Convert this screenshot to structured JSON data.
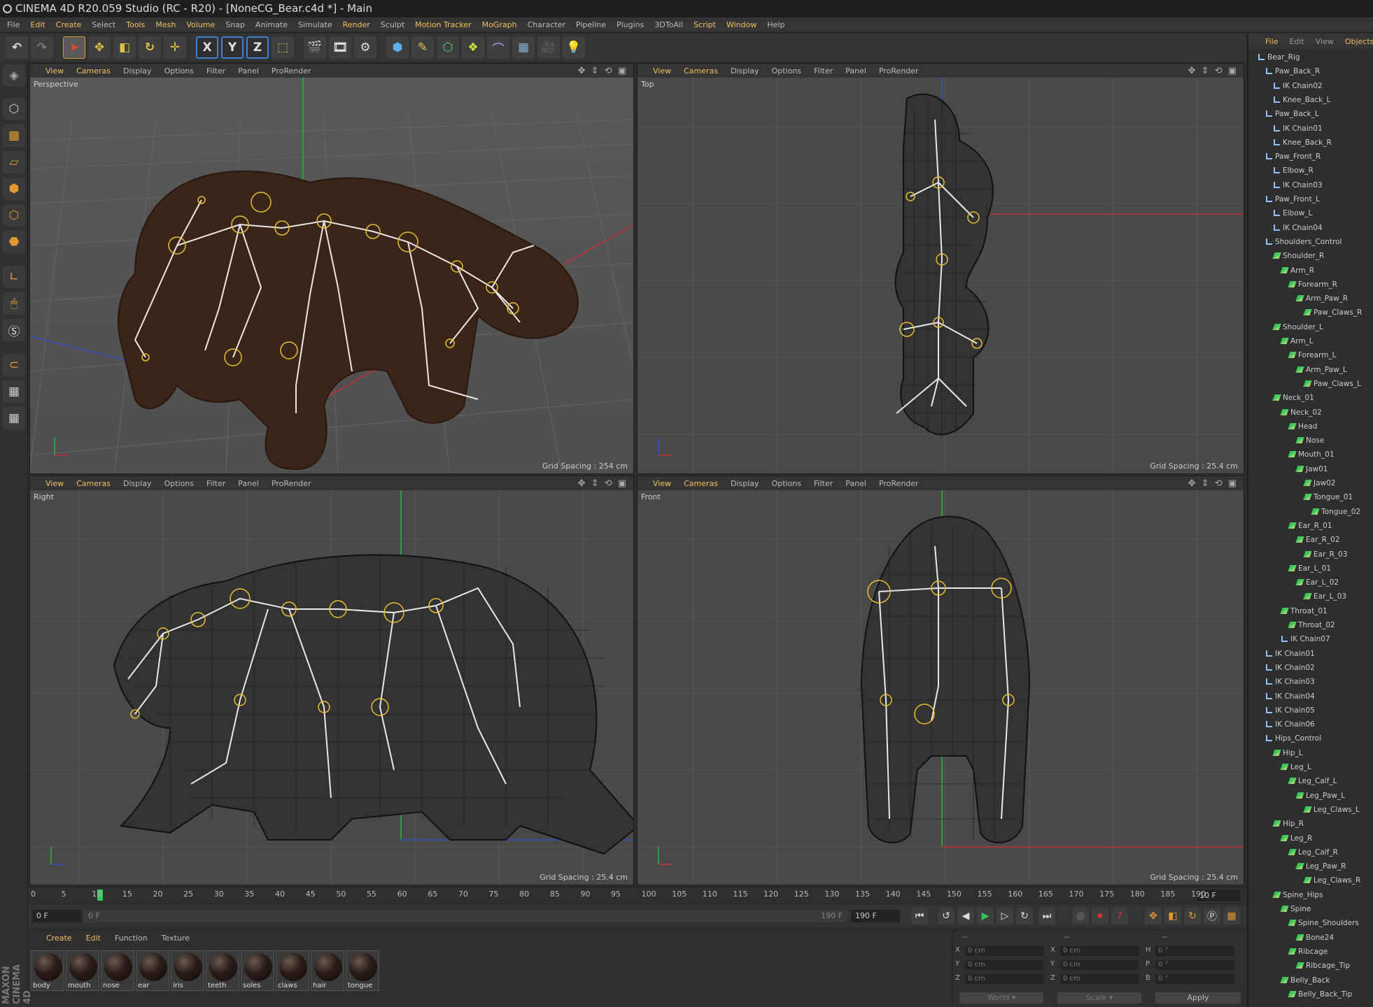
{
  "window": {
    "title": "CINEMA 4D R20.059 Studio (RC - R20) - [NoneCG_Bear.c4d *] - Main"
  },
  "menu": [
    "File",
    "Edit",
    "Create",
    "Select",
    "Tools",
    "Mesh",
    "Volume",
    "Snap",
    "Animate",
    "Simulate",
    "Render",
    "Sculpt",
    "Motion Tracker",
    "MoGraph",
    "Character",
    "Pipeline",
    "Plugins",
    "3DToAll",
    "Script",
    "Window",
    "Help"
  ],
  "viewport_menu": [
    "View",
    "Cameras",
    "Display",
    "Options",
    "Filter",
    "Panel",
    "ProRender"
  ],
  "viewports": [
    {
      "name": "Perspective",
      "grid": "Grid Spacing : 254 cm"
    },
    {
      "name": "Top",
      "grid": "Grid Spacing : 25.4 cm"
    },
    {
      "name": "Right",
      "grid": "Grid Spacing : 25.4 cm"
    },
    {
      "name": "Front",
      "grid": "Grid Spacing : 25.4 cm"
    }
  ],
  "timeline": {
    "ticks": [
      "0",
      "5",
      "10",
      "15",
      "20",
      "25",
      "30",
      "35",
      "40",
      "45",
      "50",
      "55",
      "60",
      "65",
      "70",
      "75",
      "80",
      "85",
      "90",
      "95",
      "100",
      "105",
      "110",
      "115",
      "120",
      "125",
      "130",
      "135",
      "140",
      "145",
      "150",
      "155",
      "160",
      "165",
      "170",
      "175",
      "180",
      "185",
      "190"
    ],
    "current_frame_field": "10 F",
    "start_field": "0 F",
    "min_field": "0 F",
    "max_field": "190 F",
    "end_field": "190 F"
  },
  "materials": {
    "tabs": [
      "Create",
      "Edit",
      "Function",
      "Texture"
    ],
    "items": [
      "body",
      "mouth",
      "nose",
      "ear",
      "iris",
      "teeth",
      "soles",
      "claws",
      "hair",
      "tongue"
    ]
  },
  "coordinates": {
    "header_left": "--",
    "header_mid": "--",
    "header_right": "--",
    "rows": [
      {
        "a": "X",
        "a_val": "0 cm",
        "b": "X",
        "b_val": "0 cm",
        "c": "H",
        "c_val": "0 °"
      },
      {
        "a": "Y",
        "a_val": "0 cm",
        "b": "Y",
        "b_val": "0 cm",
        "c": "P",
        "c_val": "0 °"
      },
      {
        "a": "Z",
        "a_val": "0 cm",
        "b": "Z",
        "b_val": "0 cm",
        "c": "B",
        "c_val": "0 °"
      }
    ],
    "world": "World",
    "scale": "Scale",
    "apply": "Apply"
  },
  "objects_panel": {
    "tabs": [
      "File",
      "Edit",
      "View",
      "Objects"
    ],
    "tree": [
      {
        "label": "Bear_Rig",
        "depth": 0,
        "type": "null"
      },
      {
        "label": "Paw_Back_R",
        "depth": 1,
        "type": "null"
      },
      {
        "label": "IK Chain02",
        "depth": 2,
        "type": "ik"
      },
      {
        "label": "Knee_Back_L",
        "depth": 2,
        "type": "null"
      },
      {
        "label": "Paw_Back_L",
        "depth": 1,
        "type": "null"
      },
      {
        "label": "IK Chain01",
        "depth": 2,
        "type": "ik"
      },
      {
        "label": "Knee_Back_R",
        "depth": 2,
        "type": "null"
      },
      {
        "label": "Paw_Front_R",
        "depth": 1,
        "type": "null"
      },
      {
        "label": "Elbow_R",
        "depth": 2,
        "type": "null"
      },
      {
        "label": "IK Chain03",
        "depth": 2,
        "type": "ik"
      },
      {
        "label": "Paw_Front_L",
        "depth": 1,
        "type": "null"
      },
      {
        "label": "Elbow_L",
        "depth": 2,
        "type": "null"
      },
      {
        "label": "IK Chain04",
        "depth": 2,
        "type": "ik"
      },
      {
        "label": "Shoulders_Control",
        "depth": 1,
        "type": "null"
      },
      {
        "label": "Shoulder_R",
        "depth": 2,
        "type": "joint"
      },
      {
        "label": "Arm_R",
        "depth": 3,
        "type": "joint"
      },
      {
        "label": "Forearm_R",
        "depth": 4,
        "type": "joint"
      },
      {
        "label": "Arm_Paw_R",
        "depth": 5,
        "type": "joint"
      },
      {
        "label": "Paw_Claws_R",
        "depth": 6,
        "type": "joint"
      },
      {
        "label": "Shoulder_L",
        "depth": 2,
        "type": "joint"
      },
      {
        "label": "Arm_L",
        "depth": 3,
        "type": "joint"
      },
      {
        "label": "Forearm_L",
        "depth": 4,
        "type": "joint"
      },
      {
        "label": "Arm_Paw_L",
        "depth": 5,
        "type": "joint"
      },
      {
        "label": "Paw_Claws_L",
        "depth": 6,
        "type": "joint"
      },
      {
        "label": "Neck_01",
        "depth": 2,
        "type": "joint"
      },
      {
        "label": "Neck_02",
        "depth": 3,
        "type": "joint"
      },
      {
        "label": "Head",
        "depth": 4,
        "type": "joint"
      },
      {
        "label": "Nose",
        "depth": 5,
        "type": "joint"
      },
      {
        "label": "Mouth_01",
        "depth": 4,
        "type": "joint"
      },
      {
        "label": "Jaw01",
        "depth": 5,
        "type": "joint"
      },
      {
        "label": "Jaw02",
        "depth": 6,
        "type": "joint"
      },
      {
        "label": "Tongue_01",
        "depth": 6,
        "type": "joint"
      },
      {
        "label": "Tongue_02",
        "depth": 7,
        "type": "joint"
      },
      {
        "label": "Ear_R_01",
        "depth": 4,
        "type": "joint"
      },
      {
        "label": "Ear_R_02",
        "depth": 5,
        "type": "joint"
      },
      {
        "label": "Ear_R_03",
        "depth": 6,
        "type": "joint"
      },
      {
        "label": "Ear_L_01",
        "depth": 4,
        "type": "joint"
      },
      {
        "label": "Ear_L_02",
        "depth": 5,
        "type": "joint"
      },
      {
        "label": "Ear_L_03",
        "depth": 6,
        "type": "joint"
      },
      {
        "label": "Throat_01",
        "depth": 3,
        "type": "joint"
      },
      {
        "label": "Throat_02",
        "depth": 4,
        "type": "joint"
      },
      {
        "label": "IK Chain07",
        "depth": 3,
        "type": "ik"
      },
      {
        "label": "IK Chain01",
        "depth": 1,
        "type": "ik"
      },
      {
        "label": "IK Chain02",
        "depth": 1,
        "type": "ik"
      },
      {
        "label": "IK Chain03",
        "depth": 1,
        "type": "ik"
      },
      {
        "label": "IK Chain04",
        "depth": 1,
        "type": "ik"
      },
      {
        "label": "IK Chain05",
        "depth": 1,
        "type": "ik"
      },
      {
        "label": "IK Chain06",
        "depth": 1,
        "type": "ik"
      },
      {
        "label": "Hips_Control",
        "depth": 1,
        "type": "null"
      },
      {
        "label": "Hip_L",
        "depth": 2,
        "type": "joint"
      },
      {
        "label": "Leg_L",
        "depth": 3,
        "type": "joint"
      },
      {
        "label": "Leg_Calf_L",
        "depth": 4,
        "type": "joint"
      },
      {
        "label": "Leg_Paw_L",
        "depth": 5,
        "type": "joint"
      },
      {
        "label": "Leg_Claws_L",
        "depth": 6,
        "type": "joint"
      },
      {
        "label": "Hip_R",
        "depth": 2,
        "type": "joint"
      },
      {
        "label": "Leg_R",
        "depth": 3,
        "type": "joint"
      },
      {
        "label": "Leg_Calf_R",
        "depth": 4,
        "type": "joint"
      },
      {
        "label": "Leg_Paw_R",
        "depth": 5,
        "type": "joint"
      },
      {
        "label": "Leg_Claws_R",
        "depth": 6,
        "type": "joint"
      },
      {
        "label": "Spine_Hips",
        "depth": 2,
        "type": "joint"
      },
      {
        "label": "Spine",
        "depth": 3,
        "type": "joint"
      },
      {
        "label": "Spine_Shoulders",
        "depth": 4,
        "type": "joint"
      },
      {
        "label": "Bone24",
        "depth": 5,
        "type": "joint"
      },
      {
        "label": "Ribcage",
        "depth": 4,
        "type": "joint"
      },
      {
        "label": "Ribcage_Tip",
        "depth": 5,
        "type": "joint"
      },
      {
        "label": "Belly_Back",
        "depth": 3,
        "type": "joint"
      },
      {
        "label": "Belly_Back_Tip",
        "depth": 4,
        "type": "joint"
      }
    ]
  },
  "colors": {
    "accent": "#f0c060",
    "joint": "#39c85a",
    "axis_x": "#c83030",
    "axis_y": "#30b040",
    "axis_z": "#3050c8"
  }
}
